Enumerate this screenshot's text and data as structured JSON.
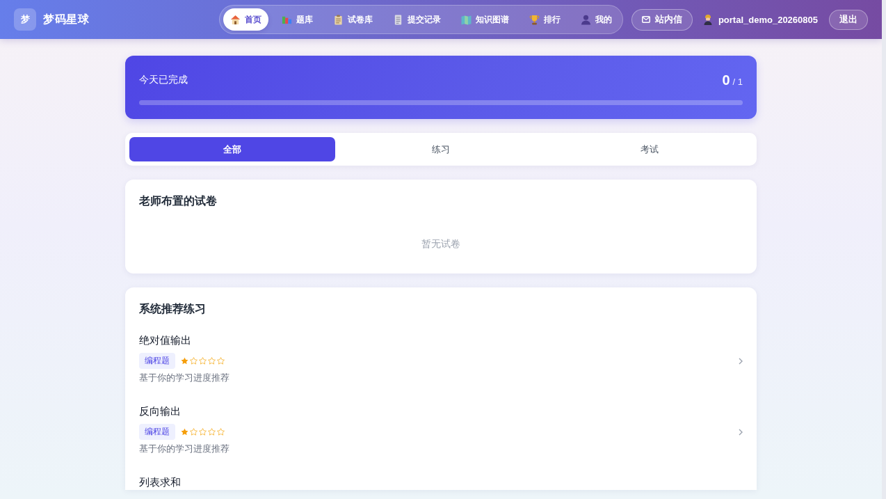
{
  "header": {
    "logo": "梦",
    "brand": "梦码星球",
    "nav": [
      {
        "label": "首页",
        "selected": true
      },
      {
        "label": "题库",
        "selected": false
      },
      {
        "label": "试卷库",
        "selected": false
      },
      {
        "label": "提交记录",
        "selected": false
      },
      {
        "label": "知识图谱",
        "selected": false
      },
      {
        "label": "排行",
        "selected": false
      },
      {
        "label": "我的",
        "selected": false
      }
    ],
    "messages": "站内信",
    "username": "portal_demo_20260805",
    "logout": "退出"
  },
  "progress": {
    "label": "今天已完成",
    "done": "0",
    "total": "/ 1"
  },
  "tabs": [
    {
      "label": "全部",
      "selected": true
    },
    {
      "label": "练习",
      "selected": false
    },
    {
      "label": "考试",
      "selected": false
    }
  ],
  "teacher_papers": {
    "title": "老师布置的试卷",
    "empty_text": "暂无试卷"
  },
  "recommended": {
    "title": "系统推荐练习",
    "items": [
      {
        "title": "绝对值输出",
        "tag": "编程题",
        "stars": 1,
        "reason": "基于你的学习进度推荐"
      },
      {
        "title": "反向输出",
        "tag": "编程题",
        "stars": 1,
        "reason": "基于你的学习进度推荐"
      },
      {
        "title": "列表求和"
      }
    ]
  }
}
